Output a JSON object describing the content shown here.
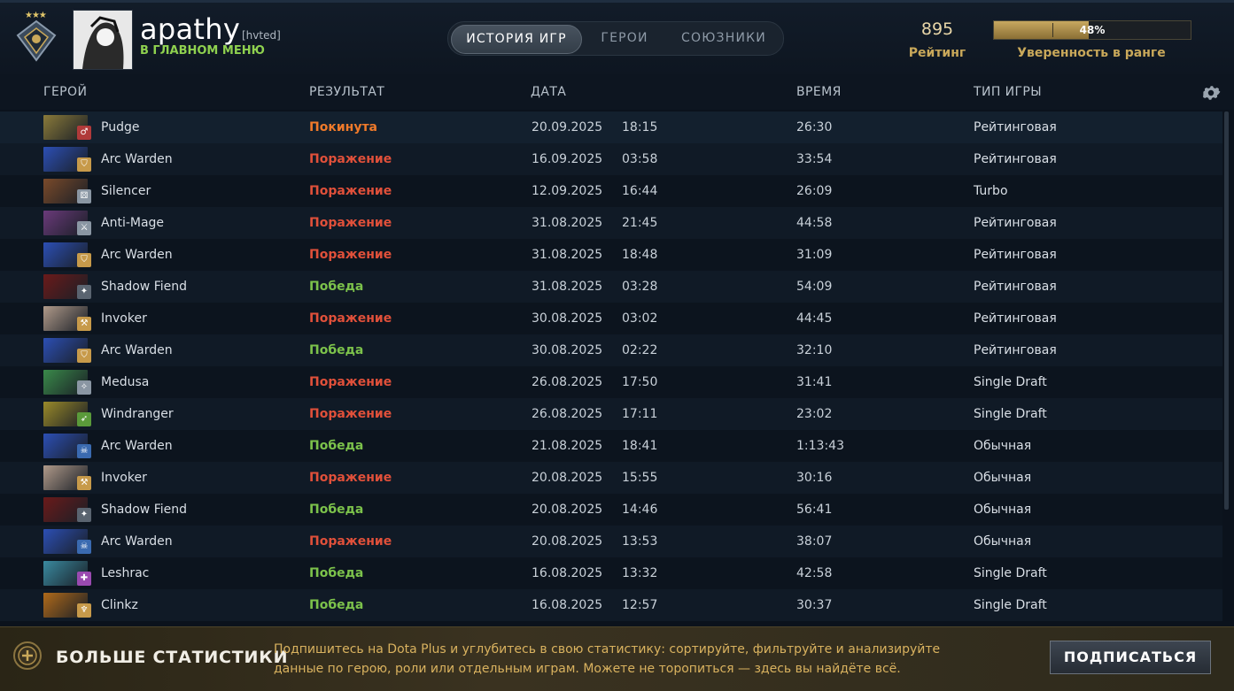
{
  "profile": {
    "username": "apathy",
    "tag": "[hvted]",
    "status": "В ГЛАВНОМ МЕНЮ",
    "rank_stars": "★★★"
  },
  "tabs": [
    {
      "label": "ИСТОРИЯ ИГР",
      "active": true
    },
    {
      "label": "ГЕРОИ",
      "active": false
    },
    {
      "label": "СОЮЗНИКИ",
      "active": false
    }
  ],
  "rating": {
    "value": "895",
    "label": "Рейтинг"
  },
  "confidence": {
    "percent_text": "48%",
    "fraction": 0.48,
    "label": "Уверенность в ранге"
  },
  "columns": {
    "hero": "ГЕРОЙ",
    "result": "РЕЗУЛЬТАТ",
    "date": "ДАТА",
    "duration": "ВРЕМЯ",
    "type": "ТИП ИГРЫ"
  },
  "matches": [
    {
      "hero": "Pudge",
      "result": "Покинута",
      "outcome": "abandon",
      "date": "20.09.2025",
      "time": "18:15",
      "duration": "26:30",
      "type": "Рейтинговая",
      "hero_color": "#8a7a3a",
      "role_color": "#b03a3a",
      "role_icon": "♂"
    },
    {
      "hero": "Arc Warden",
      "result": "Поражение",
      "outcome": "loss",
      "date": "16.09.2025",
      "time": "03:58",
      "duration": "33:54",
      "type": "Рейтинговая",
      "hero_color": "#2c4fb5",
      "role_color": "#c79a4a",
      "role_icon": "⛉"
    },
    {
      "hero": "Silencer",
      "result": "Поражение",
      "outcome": "loss",
      "date": "12.09.2025",
      "time": "16:44",
      "duration": "26:09",
      "type": "Turbo",
      "hero_color": "#7a4a2a",
      "role_color": "#8a96a3",
      "role_icon": "⚄"
    },
    {
      "hero": "Anti-Mage",
      "result": "Поражение",
      "outcome": "loss",
      "date": "31.08.2025",
      "time": "21:45",
      "duration": "44:58",
      "type": "Рейтинговая",
      "hero_color": "#6a3a7a",
      "role_color": "#8a96a3",
      "role_icon": "⚔"
    },
    {
      "hero": "Arc Warden",
      "result": "Поражение",
      "outcome": "loss",
      "date": "31.08.2025",
      "time": "18:48",
      "duration": "31:09",
      "type": "Рейтинговая",
      "hero_color": "#2c4fb5",
      "role_color": "#c79a4a",
      "role_icon": "⛉"
    },
    {
      "hero": "Shadow Fiend",
      "result": "Победа",
      "outcome": "win",
      "date": "31.08.2025",
      "time": "03:28",
      "duration": "54:09",
      "type": "Рейтинговая",
      "hero_color": "#6a1a1a",
      "role_color": "#5a6470",
      "role_icon": "✦"
    },
    {
      "hero": "Invoker",
      "result": "Поражение",
      "outcome": "loss",
      "date": "30.08.2025",
      "time": "03:02",
      "duration": "44:45",
      "type": "Рейтинговая",
      "hero_color": "#b09a8a",
      "role_color": "#c79a4a",
      "role_icon": "⚒"
    },
    {
      "hero": "Arc Warden",
      "result": "Победа",
      "outcome": "win",
      "date": "30.08.2025",
      "time": "02:22",
      "duration": "32:10",
      "type": "Рейтинговая",
      "hero_color": "#2c4fb5",
      "role_color": "#c79a4a",
      "role_icon": "⛉"
    },
    {
      "hero": "Medusa",
      "result": "Поражение",
      "outcome": "loss",
      "date": "26.08.2025",
      "time": "17:50",
      "duration": "31:41",
      "type": "Single Draft",
      "hero_color": "#3a8a4a",
      "role_color": "#8a96a3",
      "role_icon": "✧"
    },
    {
      "hero": "Windranger",
      "result": "Поражение",
      "outcome": "loss",
      "date": "26.08.2025",
      "time": "17:11",
      "duration": "23:02",
      "type": "Single Draft",
      "hero_color": "#9a8a2a",
      "role_color": "#5a9a3a",
      "role_icon": "➶"
    },
    {
      "hero": "Arc Warden",
      "result": "Победа",
      "outcome": "win",
      "date": "21.08.2025",
      "time": "18:41",
      "duration": "1:13:43",
      "type": "Обычная",
      "hero_color": "#2c4fb5",
      "role_color": "#3a6ab0",
      "role_icon": "☠"
    },
    {
      "hero": "Invoker",
      "result": "Поражение",
      "outcome": "loss",
      "date": "20.08.2025",
      "time": "15:55",
      "duration": "30:16",
      "type": "Обычная",
      "hero_color": "#b09a8a",
      "role_color": "#c79a4a",
      "role_icon": "⚒"
    },
    {
      "hero": "Shadow Fiend",
      "result": "Победа",
      "outcome": "win",
      "date": "20.08.2025",
      "time": "14:46",
      "duration": "56:41",
      "type": "Обычная",
      "hero_color": "#6a1a1a",
      "role_color": "#5a6470",
      "role_icon": "✦"
    },
    {
      "hero": "Arc Warden",
      "result": "Поражение",
      "outcome": "loss",
      "date": "20.08.2025",
      "time": "13:53",
      "duration": "38:07",
      "type": "Обычная",
      "hero_color": "#2c4fb5",
      "role_color": "#3a6ab0",
      "role_icon": "☠"
    },
    {
      "hero": "Leshrac",
      "result": "Победа",
      "outcome": "win",
      "date": "16.08.2025",
      "time": "13:32",
      "duration": "42:58",
      "type": "Single Draft",
      "hero_color": "#3a8aa0",
      "role_color": "#9a4ab0",
      "role_icon": "✚"
    },
    {
      "hero": "Clinkz",
      "result": "Победа",
      "outcome": "win",
      "date": "16.08.2025",
      "time": "12:57",
      "duration": "30:37",
      "type": "Single Draft",
      "hero_color": "#b06a1a",
      "role_color": "#c79a4a",
      "role_icon": "♆"
    }
  ],
  "footer": {
    "title": "БОЛЬШЕ СТАТИСТИКИ",
    "text": "Подпишитесь на Dota Plus и углубитесь в свою статистику: сортируйте, фильтруйте и анализируйте данные по герою, роли или отдельным играм. Можете не торопиться — здесь вы найдёте всё.",
    "button": "ПОДПИСАТЬСЯ"
  },
  "colors": {
    "loss": "#e0503a",
    "win": "#7cc24b",
    "abandon": "#f07a2a",
    "status": "#8fd14f",
    "gold": "#c9a85a"
  }
}
